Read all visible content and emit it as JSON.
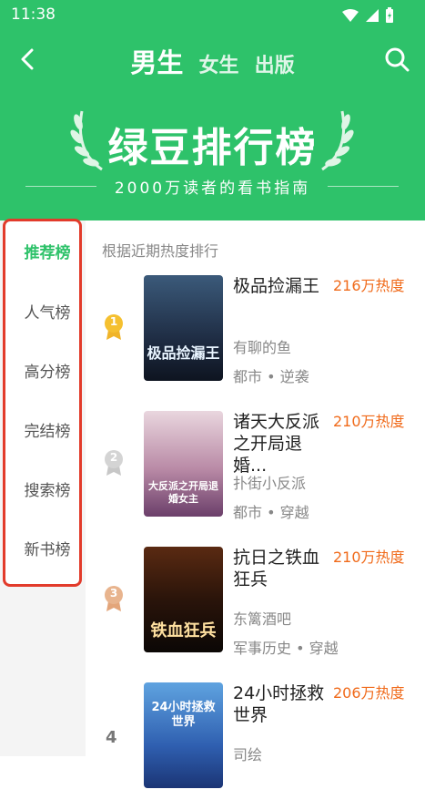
{
  "status": {
    "time": "11:38"
  },
  "header": {
    "tabs": [
      {
        "label": "男生",
        "active": true
      },
      {
        "label": "女生",
        "active": false
      },
      {
        "label": "出版",
        "active": false
      }
    ]
  },
  "banner": {
    "title": "绿豆排行榜",
    "subtitle": "2000万读者的看书指南"
  },
  "sidebar": {
    "items": [
      {
        "label": "推荐榜",
        "active": true
      },
      {
        "label": "人气榜"
      },
      {
        "label": "高分榜"
      },
      {
        "label": "完结榜"
      },
      {
        "label": "搜索榜"
      },
      {
        "label": "新书榜"
      }
    ]
  },
  "list": {
    "hint": "根据近期热度排行",
    "books": [
      {
        "rank": "1",
        "title": "极品捡漏王",
        "heat": "216万热度",
        "author": "有聊的鱼",
        "tags": "都市 • 逆袭",
        "cover_text": "极品捡漏王"
      },
      {
        "rank": "2",
        "title": "诸天大反派之开局退婚...",
        "heat": "210万热度",
        "author": "扑街小反派",
        "tags": "都市 • 穿越",
        "cover_text": "大反派之开局退婚女主"
      },
      {
        "rank": "3",
        "title": "抗日之铁血狂兵",
        "heat": "210万热度",
        "author": "东篱酒吧",
        "tags": "军事历史 • 穿越",
        "cover_text": "铁血狂兵"
      },
      {
        "rank": "4",
        "title": "24小时拯救世界",
        "heat": "206万热度",
        "author": "司绘",
        "tags": "",
        "cover_text": "24小时拯救世界"
      }
    ]
  },
  "colors": {
    "brand": "#2ec26a",
    "heat": "#f06a1a",
    "highlight": "#e23b2b"
  }
}
